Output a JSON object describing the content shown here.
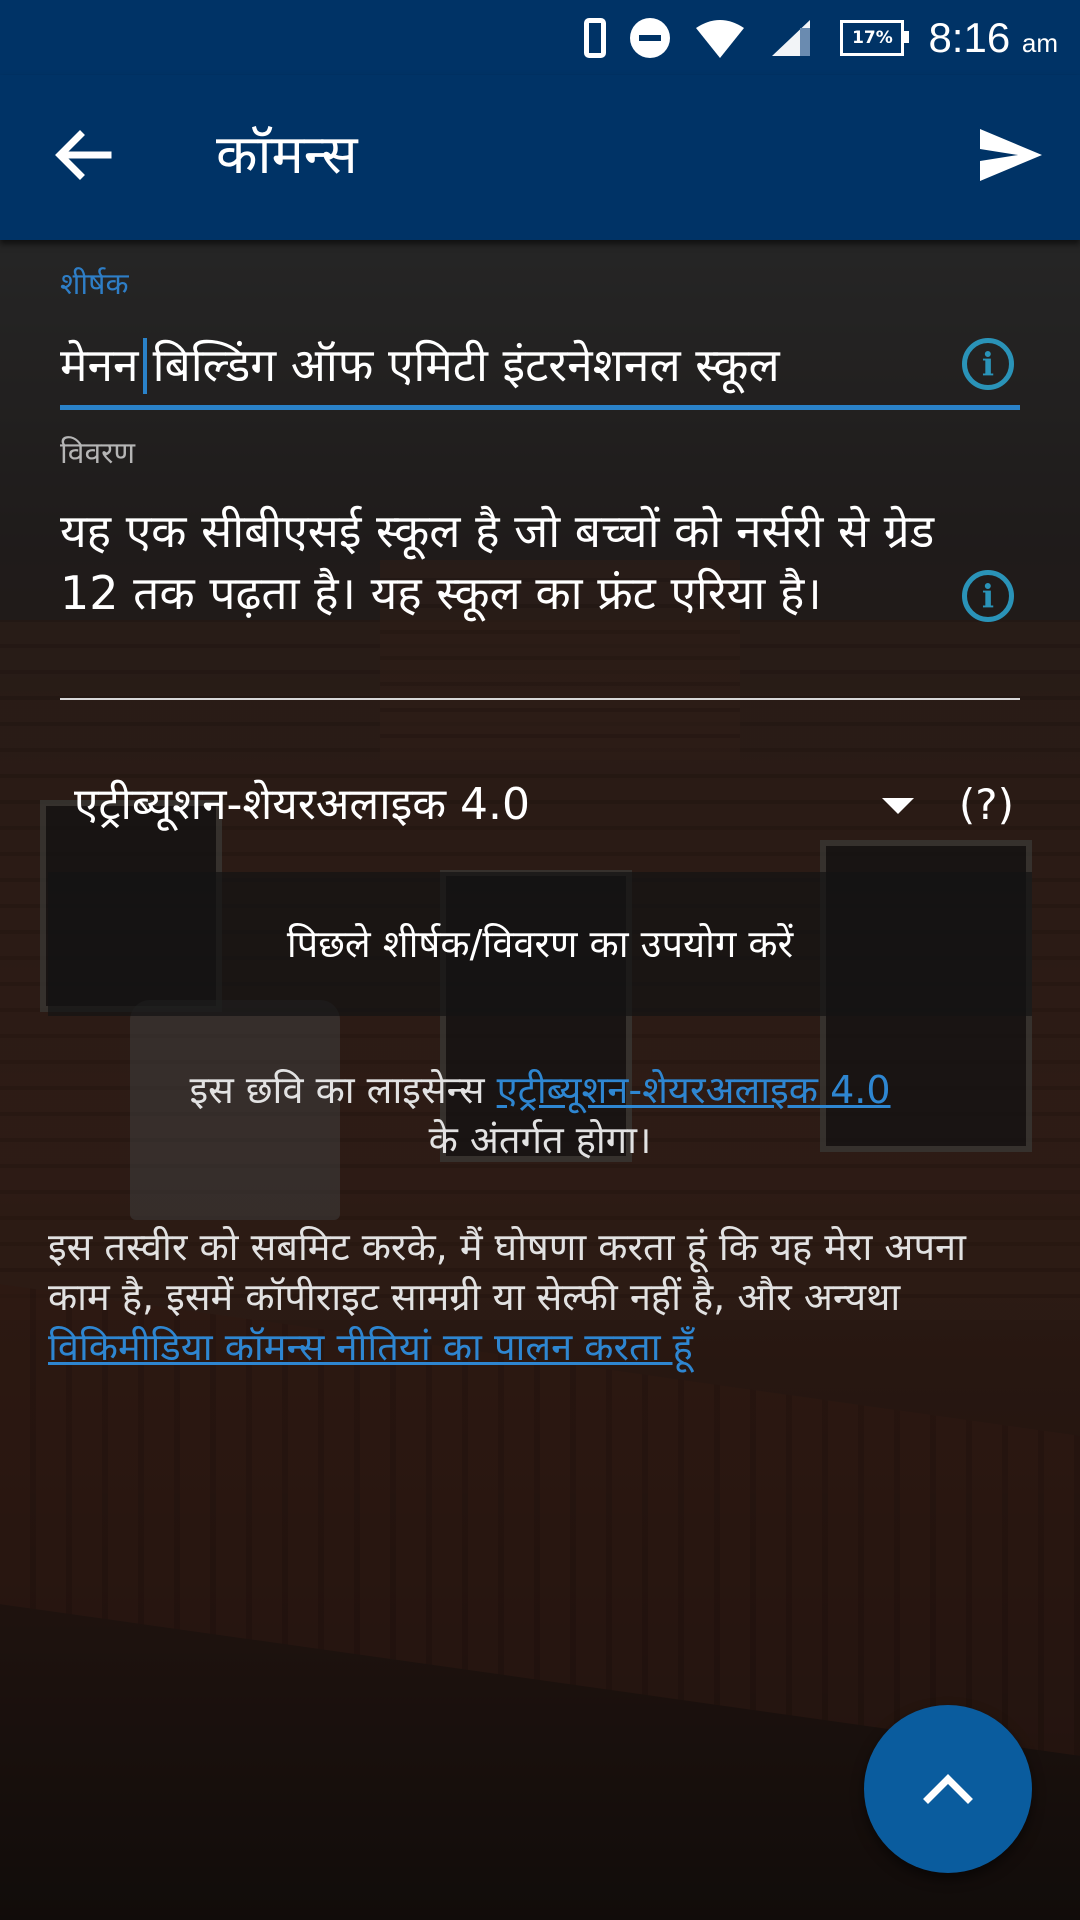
{
  "status_bar": {
    "battery": "17%",
    "time": "8:16",
    "ampm": "am"
  },
  "toolbar": {
    "title": "कॉमन्स"
  },
  "form": {
    "title_label": "शीर्षक",
    "title_value_before_caret": "मेनन",
    "title_value_after_caret": "बिल्डिंग ऑफ एमिटी इंटरनेशनल स्कूल",
    "description_label": "विवरण",
    "description_value": "यह एक सीबीएसई स्कूल है जो बच्चों को नर्सरी से ग्रेड 12 तक पढ़ता है। यह स्कूल का फ्रंट एरिया है।",
    "license_selected": "एट्रीब्यूशन-शेयरअलाइक 4.0",
    "license_help": "(?)",
    "previous_button": "पिछले शीर्षक/विवरण का उपयोग करें"
  },
  "license_note": {
    "prefix": "इस छवि का लाइसेन्स",
    "link": "एट्रीब्यूशन-शेयरअलाइक 4.0",
    "suffix": "के अंतर्गत होगा।"
  },
  "declaration": {
    "text": "इस तस्वीर को सबमिट करके, मैं घोषणा करता हूं कि यह मेरा अपना काम है, इसमें कॉपीराइट सामग्री या सेल्फी नहीं है, और अन्यथा",
    "link": "विकिमीडिया कॉमन्स नीतियां का पालन करता हूँ"
  },
  "colors": {
    "primary": "#003366",
    "accent": "#2a82c9",
    "fab": "#0a5c9e"
  },
  "icons": {
    "back": "arrow-left-icon",
    "send": "send-icon",
    "info": "info-icon",
    "dropdown": "dropdown-arrow-icon",
    "fab": "chevron-up-icon"
  }
}
